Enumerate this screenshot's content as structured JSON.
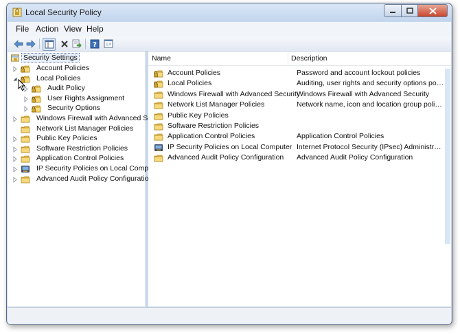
{
  "window": {
    "title": "Local Security Policy",
    "buttons": {
      "minimize": "minimize",
      "maximize": "maximize",
      "close": "close"
    }
  },
  "menu": [
    "File",
    "Action",
    "View",
    "Help"
  ],
  "toolbar": [
    "back-arrow-icon",
    "forward-arrow-icon",
    "show-hide-tree-icon",
    "delete-icon",
    "export-list-icon",
    "help-icon",
    "properties-icon"
  ],
  "tree": {
    "root": "Security Settings",
    "items": [
      {
        "label": "Account Policies",
        "depth": 1,
        "expander": "collapsed",
        "icon": "folder-lock-icon"
      },
      {
        "label": "Local Policies",
        "depth": 1,
        "expander": "expanded",
        "icon": "folder-lock-icon"
      },
      {
        "label": "Audit Policy",
        "depth": 2,
        "expander": "collapsed",
        "icon": "folder-lock-icon"
      },
      {
        "label": "User Rights Assignment",
        "depth": 2,
        "expander": "collapsed",
        "icon": "folder-lock-icon"
      },
      {
        "label": "Security Options",
        "depth": 2,
        "expander": "collapsed",
        "icon": "folder-lock-icon"
      },
      {
        "label": "Windows Firewall with Advanced Security",
        "depth": 1,
        "expander": "collapsed",
        "icon": "folder-icon"
      },
      {
        "label": "Network List Manager Policies",
        "depth": 1,
        "expander": "none",
        "icon": "folder-icon"
      },
      {
        "label": "Public Key Policies",
        "depth": 1,
        "expander": "collapsed",
        "icon": "folder-icon"
      },
      {
        "label": "Software Restriction Policies",
        "depth": 1,
        "expander": "collapsed",
        "icon": "folder-icon"
      },
      {
        "label": "Application Control Policies",
        "depth": 1,
        "expander": "collapsed",
        "icon": "folder-icon"
      },
      {
        "label": "IP Security Policies on Local Computer",
        "depth": 1,
        "expander": "collapsed",
        "icon": "ip-security-icon"
      },
      {
        "label": "Advanced Audit Policy Configuration",
        "depth": 1,
        "expander": "collapsed",
        "icon": "folder-icon"
      }
    ]
  },
  "list": {
    "columns": [
      "Name",
      "Description"
    ],
    "rows": [
      {
        "name": "Account Policies",
        "description": "Password and account lockout policies",
        "icon": "folder-lock-icon"
      },
      {
        "name": "Local Policies",
        "description": "Auditing, user rights and security options polici...",
        "icon": "folder-lock-icon"
      },
      {
        "name": "Windows Firewall with Advanced Security",
        "description": "Windows Firewall with Advanced Security",
        "icon": "folder-icon"
      },
      {
        "name": "Network List Manager Policies",
        "description": "Network name, icon and location group policies.",
        "icon": "folder-icon"
      },
      {
        "name": "Public Key Policies",
        "description": "",
        "icon": "folder-icon"
      },
      {
        "name": "Software Restriction Policies",
        "description": "",
        "icon": "folder-icon"
      },
      {
        "name": "Application Control Policies",
        "description": "Application Control Policies",
        "icon": "folder-icon"
      },
      {
        "name": "IP Security Policies on Local Computer",
        "description": "Internet Protocol Security (IPsec) Administratio...",
        "icon": "ip-security-icon"
      },
      {
        "name": "Advanced Audit Policy Configuration",
        "description": "Advanced Audit Policy Configuration",
        "icon": "folder-icon"
      }
    ]
  },
  "colors": {
    "frame": "#c9daee",
    "folder": "#f2cf6a",
    "lock": "#c9a227",
    "close": "#c8472e"
  }
}
